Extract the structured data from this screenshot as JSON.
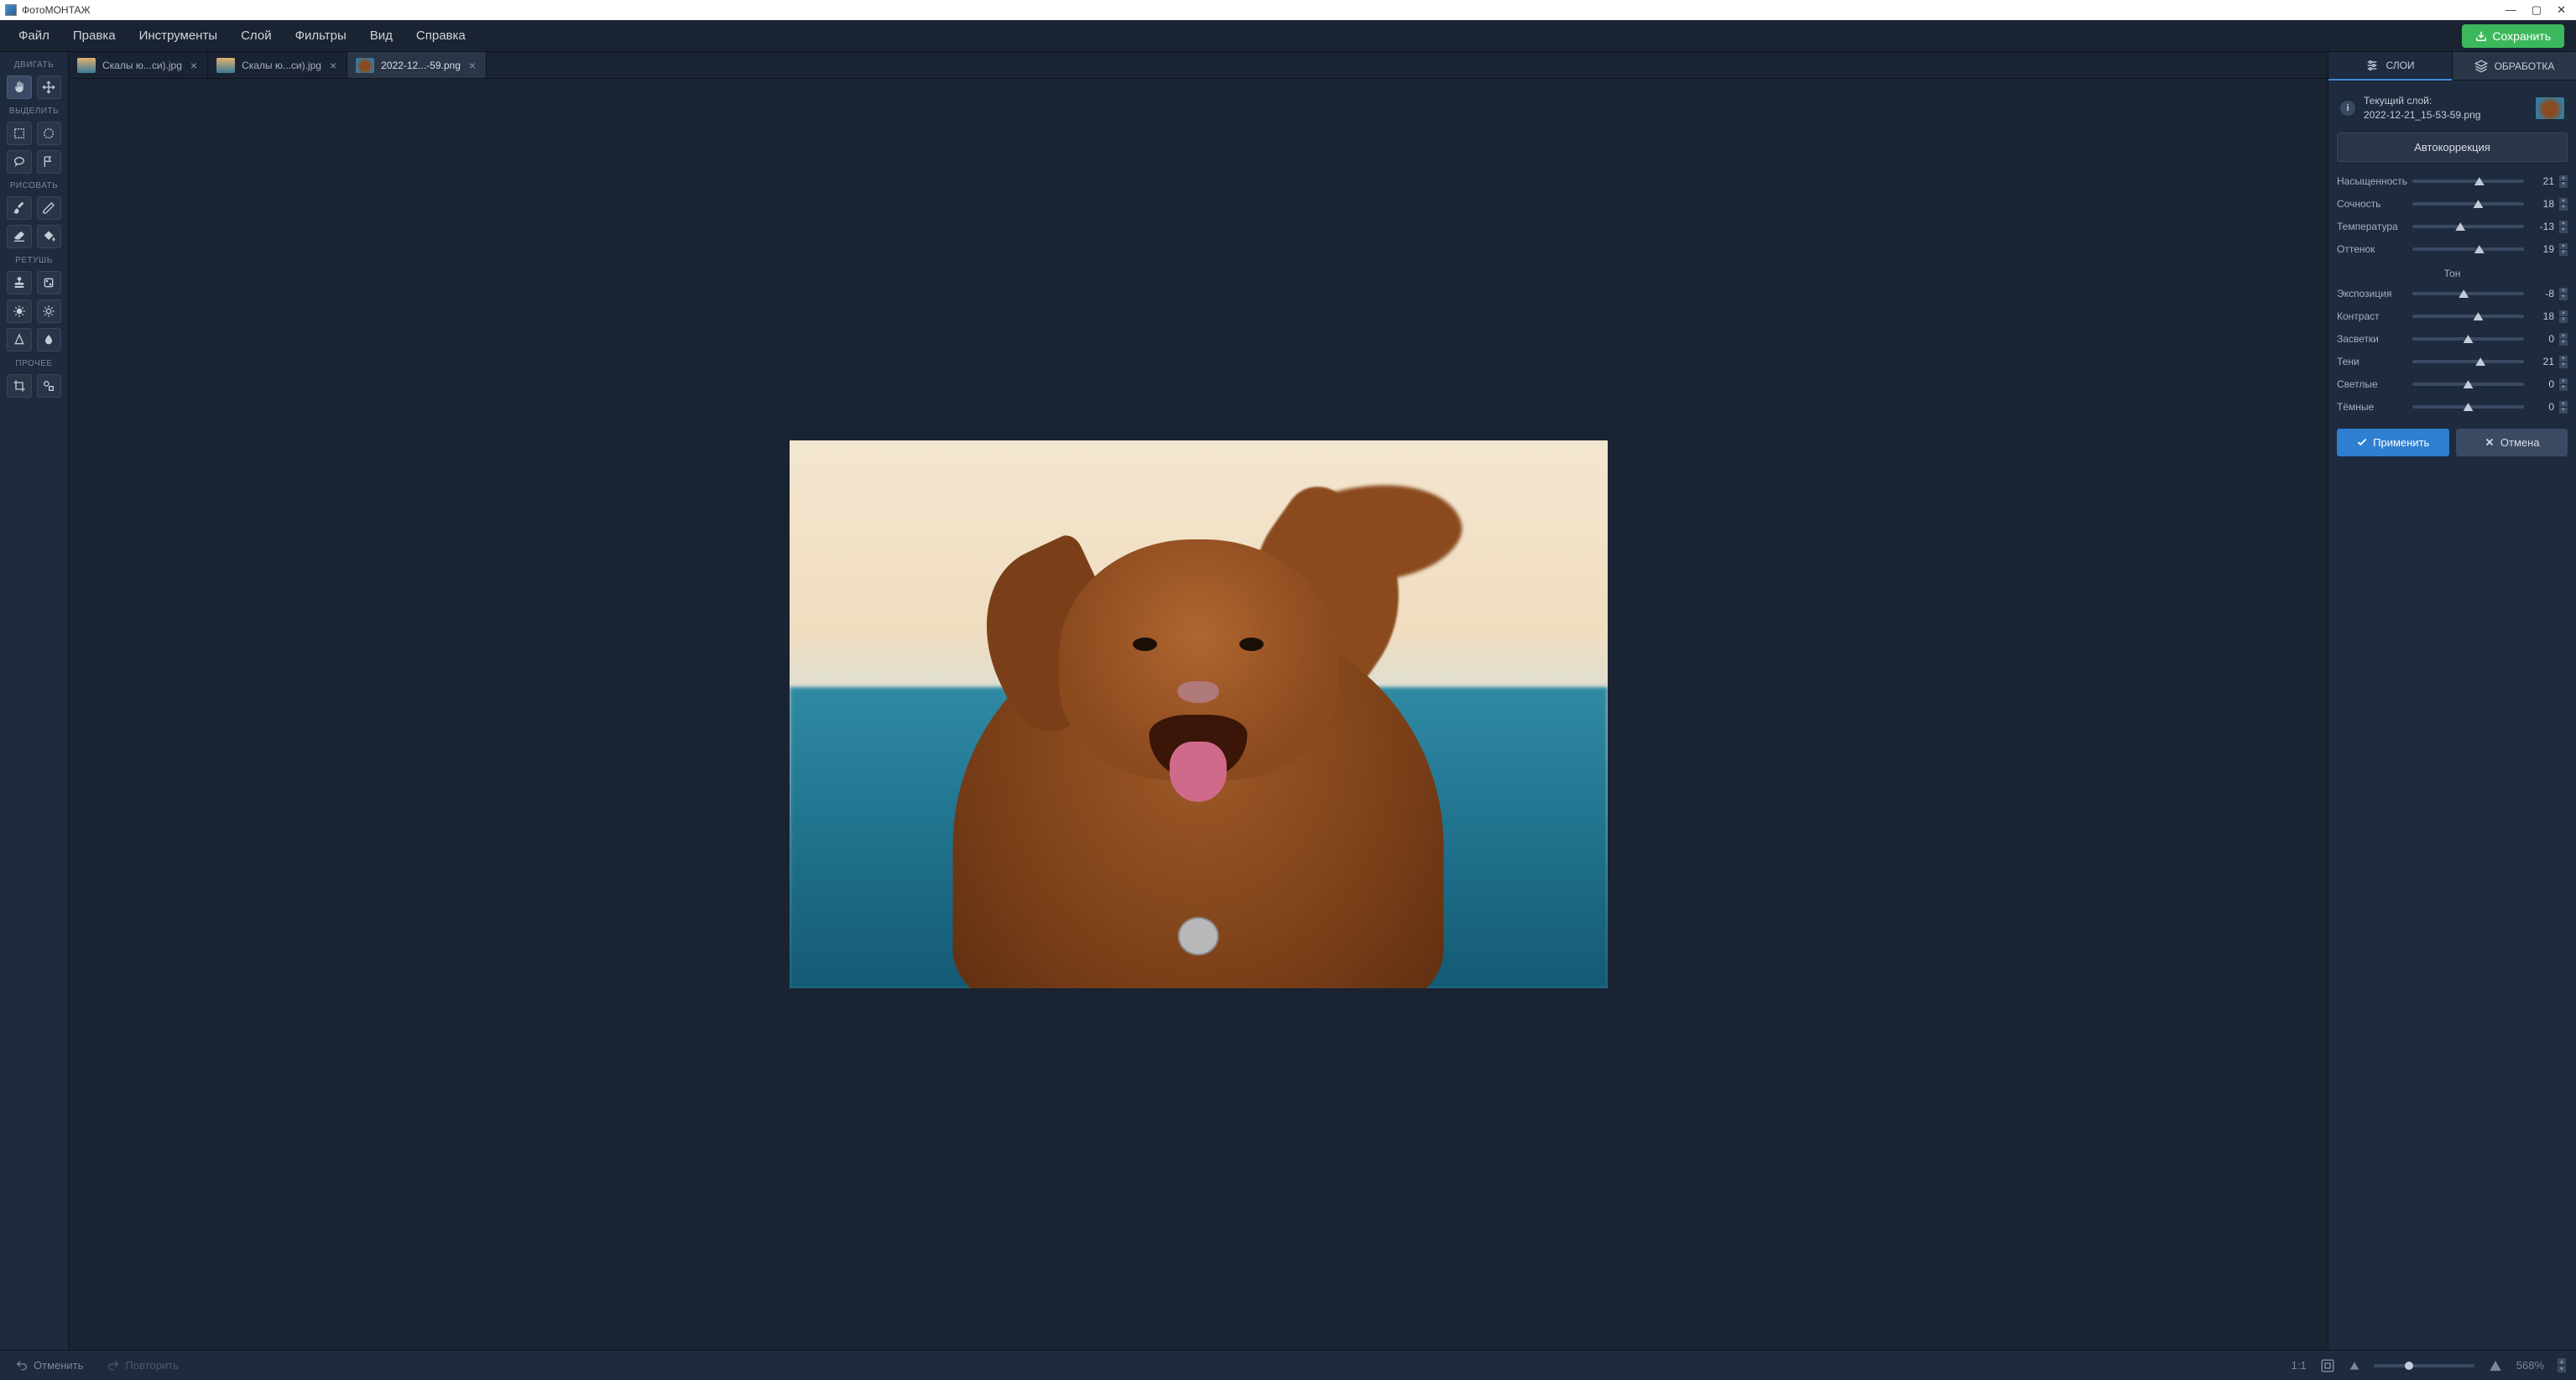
{
  "app_title": "ФотоМОНТАЖ",
  "menubar": {
    "items": [
      "Файл",
      "Правка",
      "Инструменты",
      "Слой",
      "Фильтры",
      "Вид",
      "Справка"
    ],
    "save_label": "Сохранить"
  },
  "toolbar": {
    "sections": {
      "move": "ДВИГАТЬ",
      "select": "ВЫДЕЛИТЬ",
      "draw": "РИСОВАТЬ",
      "retouch": "РЕТУШЬ",
      "other": "ПРОЧЕЕ"
    }
  },
  "tabs": [
    {
      "label": "Скалы ю...си).jpg",
      "active": false
    },
    {
      "label": "Скалы ю...си).jpg",
      "active": false
    },
    {
      "label": "2022-12...-59.png",
      "active": true
    }
  ],
  "right_panel": {
    "tabs": {
      "layers": "СЛОИ",
      "edit": "ОБРАБОТКА"
    },
    "layer_info": {
      "title": "Текущий слой:",
      "filename": "2022-12-21_15-53-59.png"
    },
    "auto_correction": "Автокоррекция",
    "sliders_color": [
      {
        "label": "Насыщенность",
        "value": 21,
        "pos": 60
      },
      {
        "label": "Сочность",
        "value": 18,
        "pos": 59
      },
      {
        "label": "Температура",
        "value": -13,
        "pos": 43
      },
      {
        "label": "Оттенок",
        "value": 19,
        "pos": 60
      }
    ],
    "tone_title": "Тон",
    "sliders_tone": [
      {
        "label": "Экспозиция",
        "value": -8,
        "pos": 46
      },
      {
        "label": "Контраст",
        "value": 18,
        "pos": 59
      },
      {
        "label": "Засветки",
        "value": 0,
        "pos": 50
      },
      {
        "label": "Тени",
        "value": 21,
        "pos": 61
      },
      {
        "label": "Светлые",
        "value": 0,
        "pos": 50
      },
      {
        "label": "Тёмные",
        "value": 0,
        "pos": 50
      }
    ],
    "apply_label": "Применить",
    "cancel_label": "Отмена"
  },
  "statusbar": {
    "undo": "Отменить",
    "redo": "Повторить",
    "ratio": "1:1",
    "zoom_value": "568%"
  }
}
